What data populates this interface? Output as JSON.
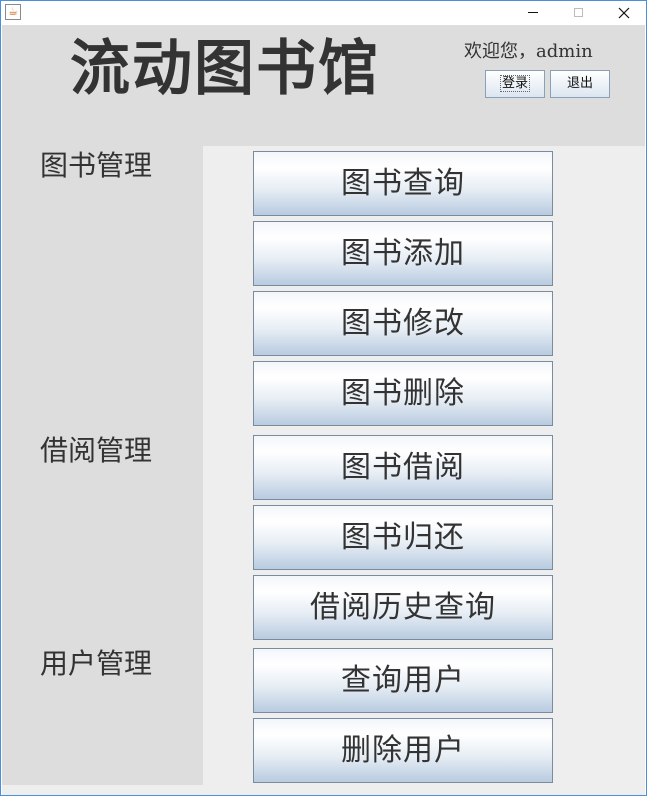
{
  "window": {
    "minimize_glyph": "",
    "maximize_glyph": "",
    "close_glyph": ""
  },
  "header": {
    "title": "流动图书馆",
    "welcome": "欢迎您，admin",
    "login_label": "登录",
    "logout_label": "退出"
  },
  "sections": {
    "book_management": "图书管理",
    "borrow_management": "借阅管理",
    "user_management": "用户管理"
  },
  "buttons": {
    "book_query": "图书查询",
    "book_add": "图书添加",
    "book_modify": "图书修改",
    "book_delete": "图书删除",
    "book_borrow": "图书借阅",
    "book_return": "图书归还",
    "borrow_history": "借阅历史查询",
    "user_query": "查询用户",
    "user_delete": "删除用户"
  },
  "icons": {
    "app": "java-coffee-icon",
    "minimize": "minimize-icon",
    "maximize": "maximize-icon",
    "close": "close-icon"
  },
  "colors": {
    "header_bg": "#dddddd",
    "content_bg": "#eeeeee",
    "button_gradient_bottom": "#b8cbe0",
    "window_border": "#4a90d9"
  }
}
